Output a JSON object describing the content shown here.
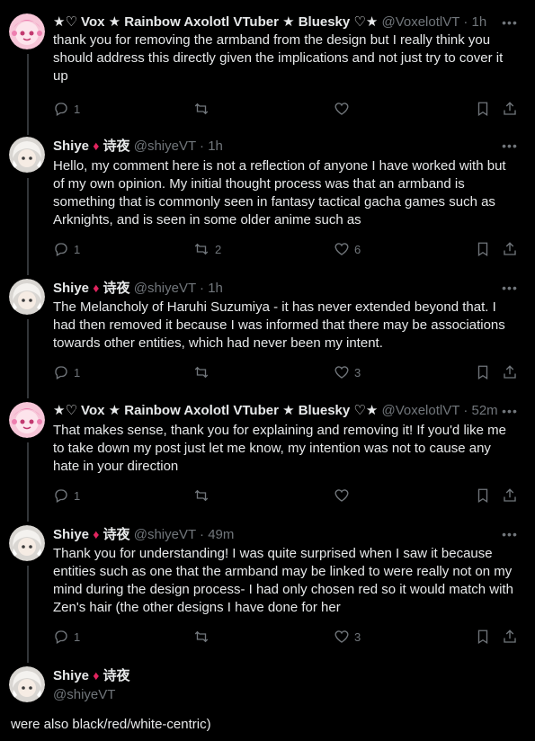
{
  "tweets": [
    {
      "name": "★♡ Vox ★ Rainbow Axolotl VTuber ★ Bluesky ♡★",
      "handle": "@VoxelotlVT",
      "time": "1h",
      "text": "thank you for removing the armband from the design but I really think you should address this directly given the implications and not just try to cover it up",
      "replies": "1",
      "retweets": "",
      "likes": ""
    },
    {
      "name": "Shiye",
      "name_suffix": "诗夜",
      "handle": "@shiyeVT",
      "time": "1h",
      "text": "Hello, my comment here is not a reflection of anyone I have worked with but of my own opinion. My initial thought process was that an armband is something that is commonly seen in fantasy tactical gacha games such as Arknights, and is seen in some older anime such as",
      "replies": "1",
      "retweets": "2",
      "likes": "6"
    },
    {
      "name": "Shiye",
      "name_suffix": "诗夜",
      "handle": "@shiyeVT",
      "time": "1h",
      "text": "The Melancholy of Haruhi Suzumiya - it has never extended beyond that. I had then removed it because I was informed that there may be associations towards other entities, which had never been my intent.",
      "replies": "1",
      "retweets": "",
      "likes": "3"
    },
    {
      "name": "★♡ Vox ★ Rainbow Axolotl VTuber ★ Bluesky ♡★",
      "handle": "@VoxelotlVT",
      "time": "52m",
      "text": "That makes sense, thank you for explaining and removing it! If you'd like me to take down my post just let me know, my intention was not to cause any hate in your direction",
      "replies": "1",
      "retweets": "",
      "likes": ""
    },
    {
      "name": "Shiye",
      "name_suffix": "诗夜",
      "handle": "@shiyeVT",
      "time": "49m",
      "text": "Thank you for understanding! I was quite surprised when I saw it because entities such as one that the armband may be linked to were really not on my mind during the design process- I had only chosen red so it would match with Zen's hair (the other designs I have done for her",
      "replies": "1",
      "retweets": "",
      "likes": "3"
    }
  ],
  "final": {
    "name": "Shiye",
    "name_suffix": "诗夜",
    "handle": "@shiyeVT",
    "text": "were also black/red/white-centric)"
  },
  "colors": {
    "background": "#000000",
    "text": "#e7e9ea",
    "muted": "#71767b",
    "diamond": "#e0245e"
  }
}
